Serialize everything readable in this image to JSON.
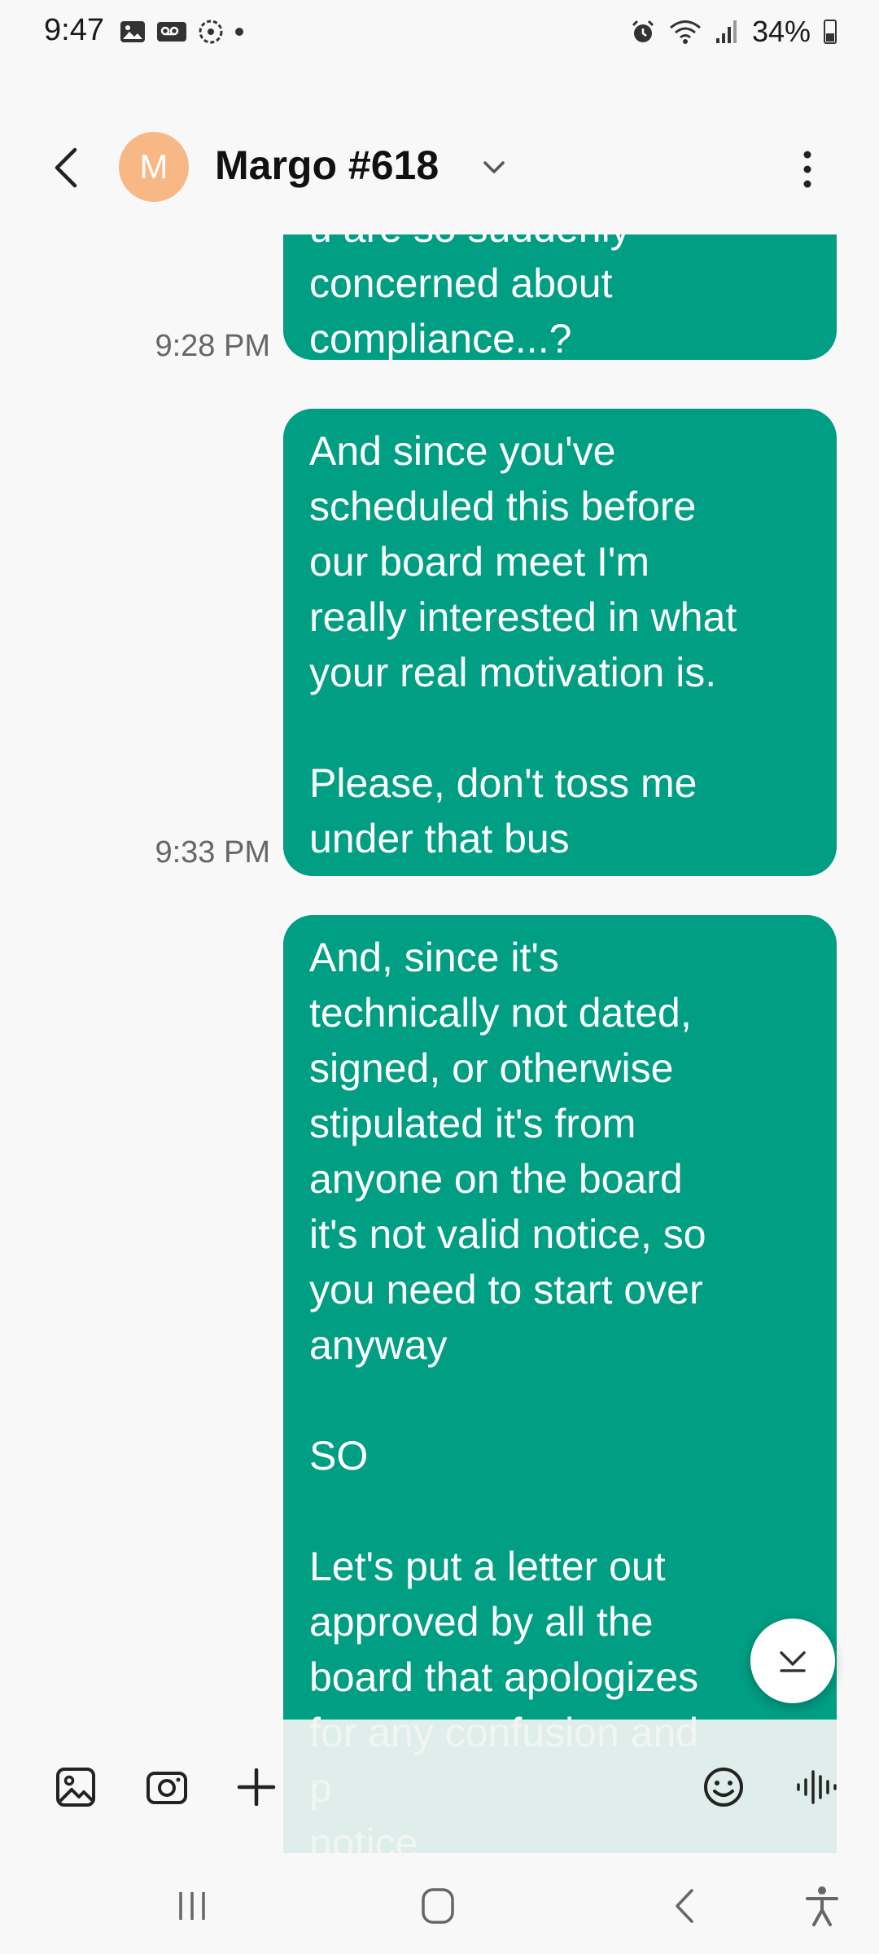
{
  "status_bar": {
    "time": "9:47",
    "battery": "34%",
    "left_icons": [
      "gallery-icon",
      "voicemail-icon",
      "sync-icon",
      "dot-icon"
    ],
    "right_icons": [
      "alarm-icon",
      "wifi-icon",
      "signal-icon",
      "battery-icon"
    ]
  },
  "header": {
    "avatar_letter": "M",
    "avatar_color": "#f7b886",
    "contact_name": "Margo #618"
  },
  "messages": [
    {
      "text": "u are so suddenly\nconcerned about\ncompliance...?",
      "time": "9:28 PM"
    },
    {
      "text": "And since you've\nscheduled this before\nour board meet I'm\nreally interested in what\nyour real motivation is.\n\nPlease, don't toss me\nunder that bus",
      "time": "9:33 PM"
    },
    {
      "text": "And, since it's\ntechnically not dated,\nsigned, or otherwise\nstipulated it's from\nanyone on the board\nit's not valid notice, so\nyou need to start over\nanyway\n\nSO\n\nLet's put a letter out\napproved by all the\nboard that apologizes\nfor any confusion and\np\nnotice",
      "time": ""
    }
  ],
  "colors": {
    "bubble": "#009e83",
    "background": "#f8f8f8"
  }
}
